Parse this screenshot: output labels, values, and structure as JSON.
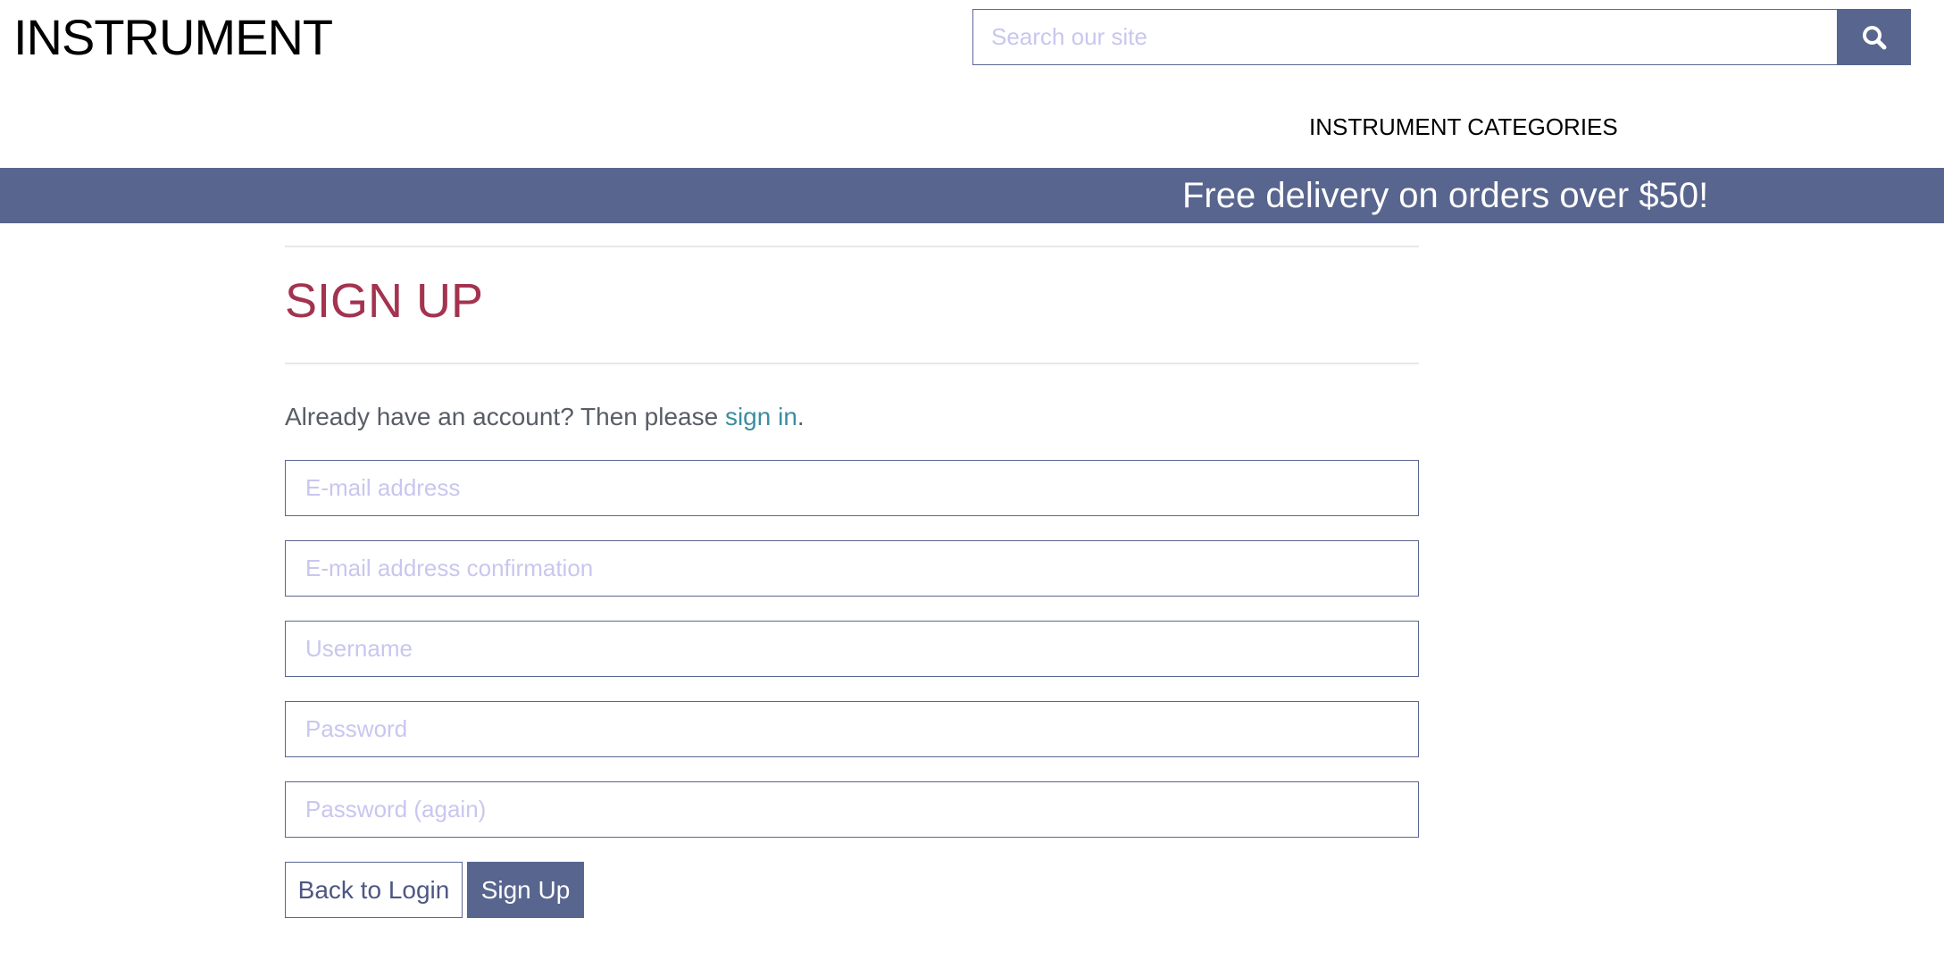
{
  "header": {
    "logo": "INSTRUMENT",
    "search": {
      "placeholder": "Search our site",
      "value": "",
      "button_icon": "search-icon"
    },
    "nav": {
      "categories_label": "INSTRUMENT CATEGORIES"
    }
  },
  "banner": {
    "text": "Free delivery on orders over $50!"
  },
  "signup": {
    "title": "SIGN UP",
    "account_prefix": "Already have an account? Then please ",
    "signin_link": "sign in",
    "account_suffix": ".",
    "fields": {
      "email_placeholder": "E-mail address",
      "email_confirm_placeholder": "E-mail address confirmation",
      "username_placeholder": "Username",
      "password_placeholder": "Password",
      "password_again_placeholder": "Password (again)"
    },
    "buttons": {
      "back_label": "Back to Login",
      "submit_label": "Sign Up"
    }
  },
  "colors": {
    "brand": "#58658e",
    "title": "#a3334f",
    "link": "#3a8da1",
    "placeholder": "#c9c6ef"
  }
}
